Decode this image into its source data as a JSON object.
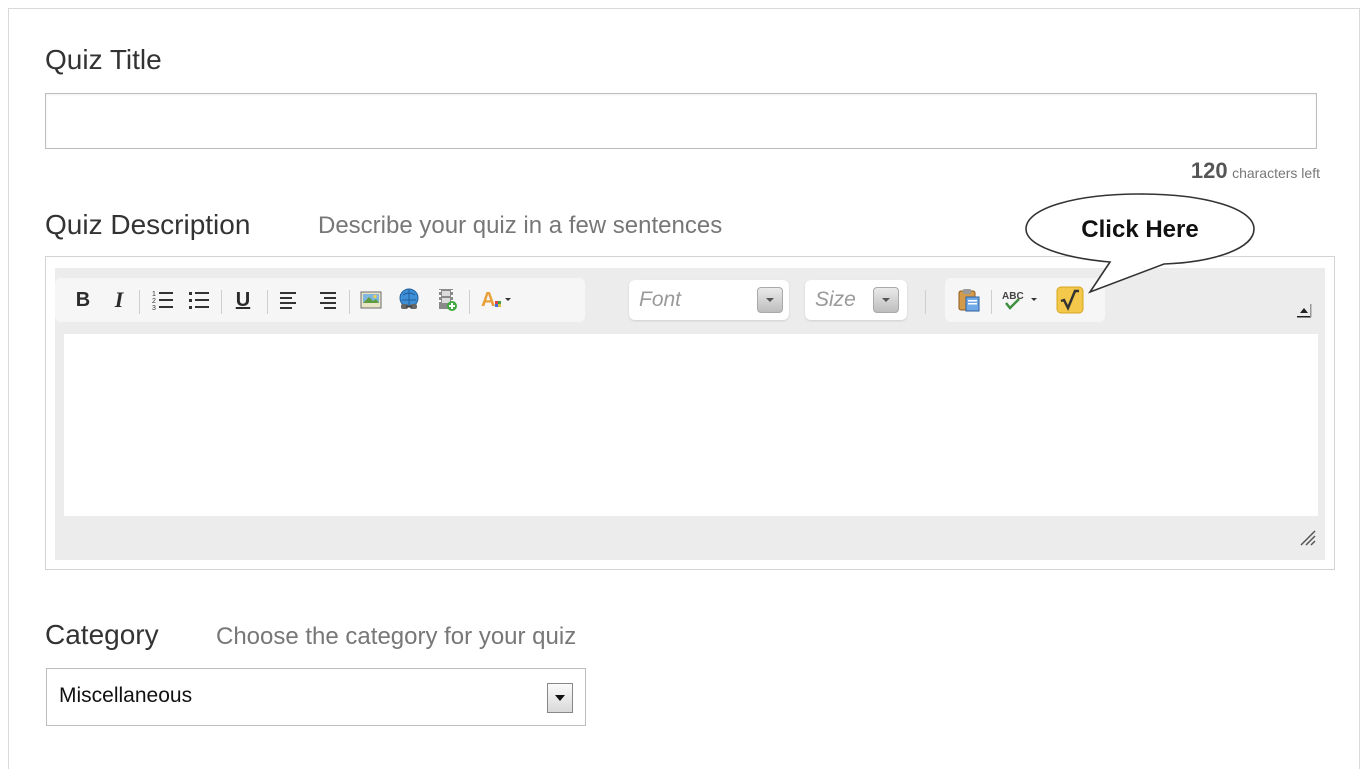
{
  "form": {
    "title_label": "Quiz Title",
    "title_value": "",
    "chars_left_count": "120",
    "chars_left_label": "characters left",
    "description_label": "Quiz Description",
    "description_hint": "Describe your quiz in a few sentences",
    "category_label": "Category",
    "category_hint": "Choose the category for your quiz",
    "category_selected": "Miscellaneous"
  },
  "editor": {
    "toolbar": {
      "bold": "B",
      "italic": "I",
      "underline": "U",
      "font_placeholder": "Font",
      "size_placeholder": "Size"
    },
    "icons": [
      "bold-icon",
      "italic-icon",
      "numbered-list-icon",
      "bullet-list-icon",
      "underline-icon",
      "align-left-icon",
      "align-right-icon",
      "image-icon",
      "link-icon",
      "video-icon",
      "text-color-icon",
      "paste-icon",
      "spellcheck-icon",
      "math-icon",
      "collapse-icon",
      "resize-grip-icon"
    ]
  },
  "callout": {
    "text": "Click Here"
  },
  "colors": {
    "math_button": "#f4c84a",
    "toolbar_bg": "#ececec",
    "hint_text": "#777777"
  }
}
